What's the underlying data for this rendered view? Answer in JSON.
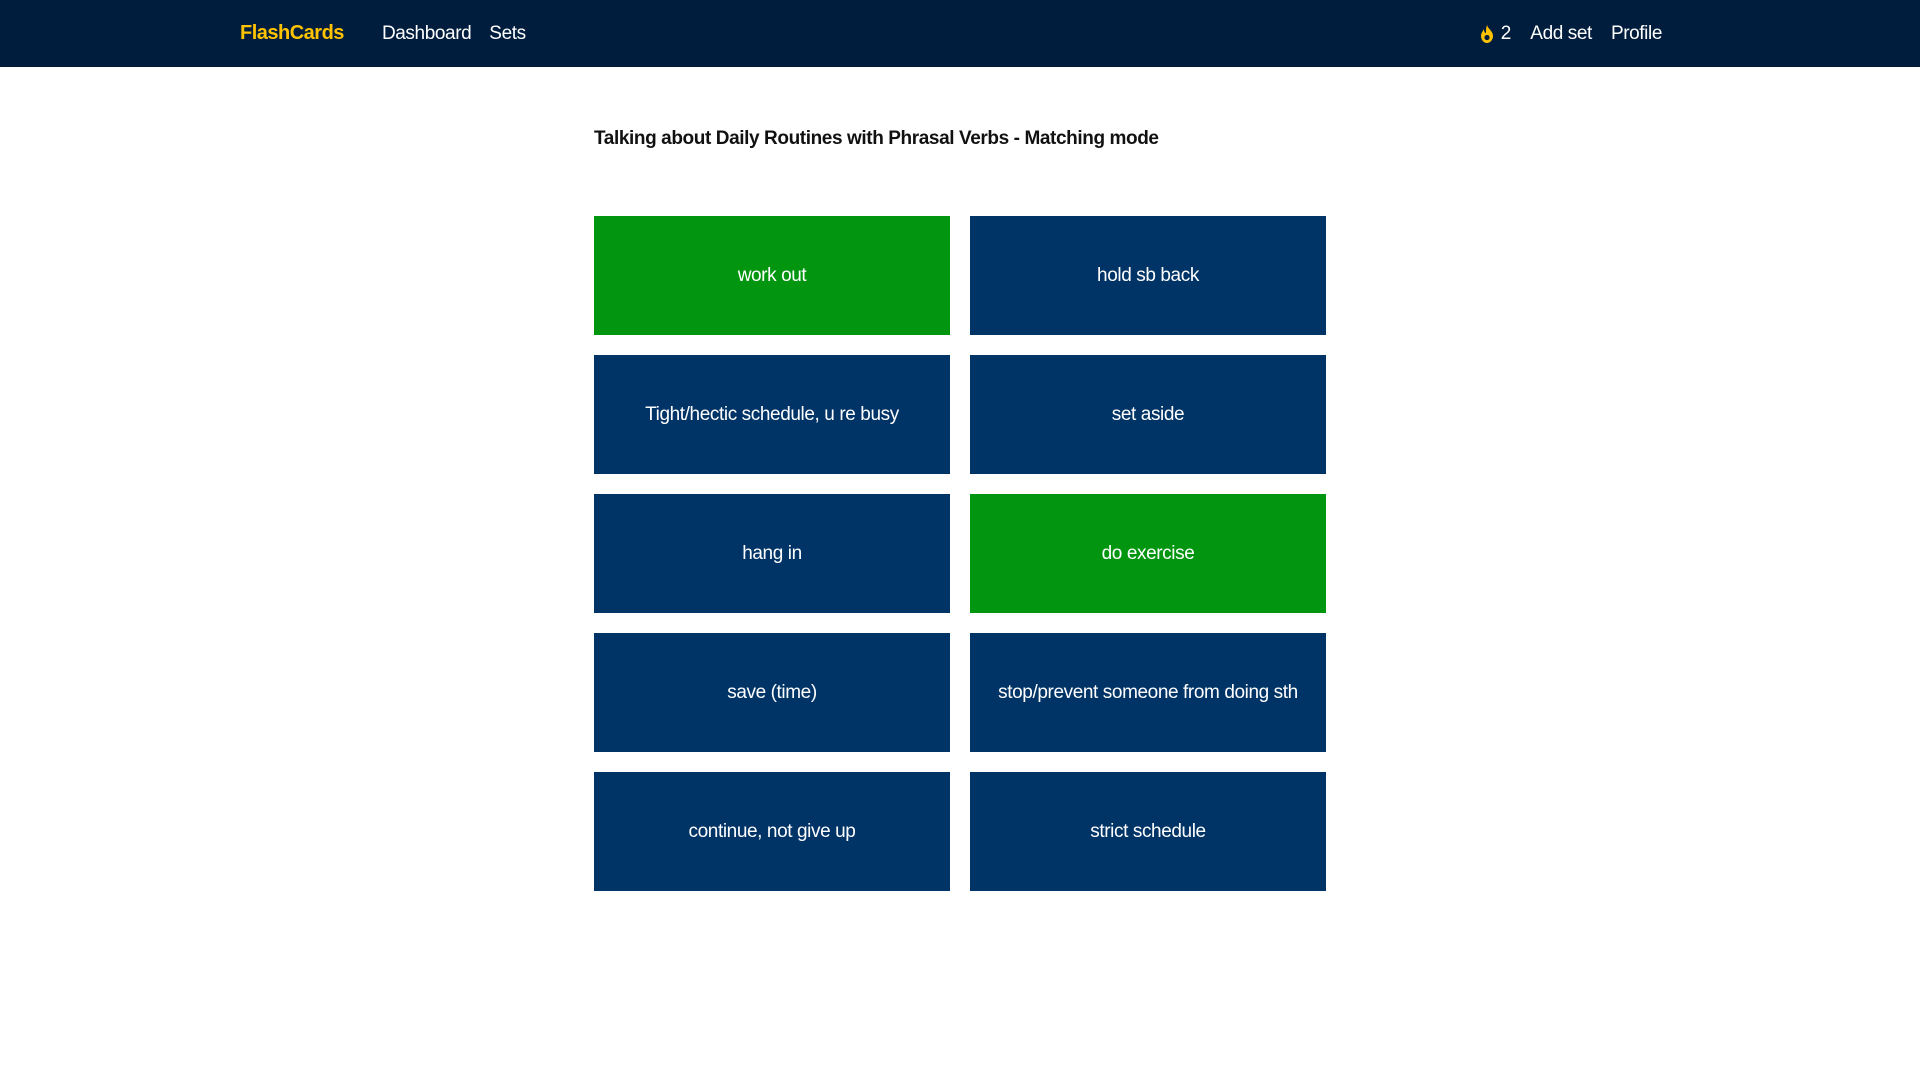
{
  "nav": {
    "brand": "FlashCards",
    "links": [
      "Dashboard",
      "Sets"
    ],
    "streak_count": "2",
    "streak_icon": "flame-icon",
    "add_set": "Add set",
    "profile": "Profile"
  },
  "title": "Talking about Daily Routines with Phrasal Verbs - Matching mode",
  "cards": [
    {
      "label": "work out",
      "matched": true
    },
    {
      "label": "hold sb back",
      "matched": false
    },
    {
      "label": "Tight/hectic schedule, u re busy",
      "matched": false
    },
    {
      "label": "set aside",
      "matched": false
    },
    {
      "label": "hang in",
      "matched": false
    },
    {
      "label": "do exercise",
      "matched": true
    },
    {
      "label": "save (time)",
      "matched": false
    },
    {
      "label": "stop/prevent someone from doing sth",
      "matched": false
    },
    {
      "label": "continue, not give up",
      "matched": false
    },
    {
      "label": "strict schedule",
      "matched": false
    }
  ],
  "colors": {
    "navbar": "#001d3d",
    "brand": "#ffc300",
    "card": "#003366",
    "card_matched": "#029610"
  }
}
